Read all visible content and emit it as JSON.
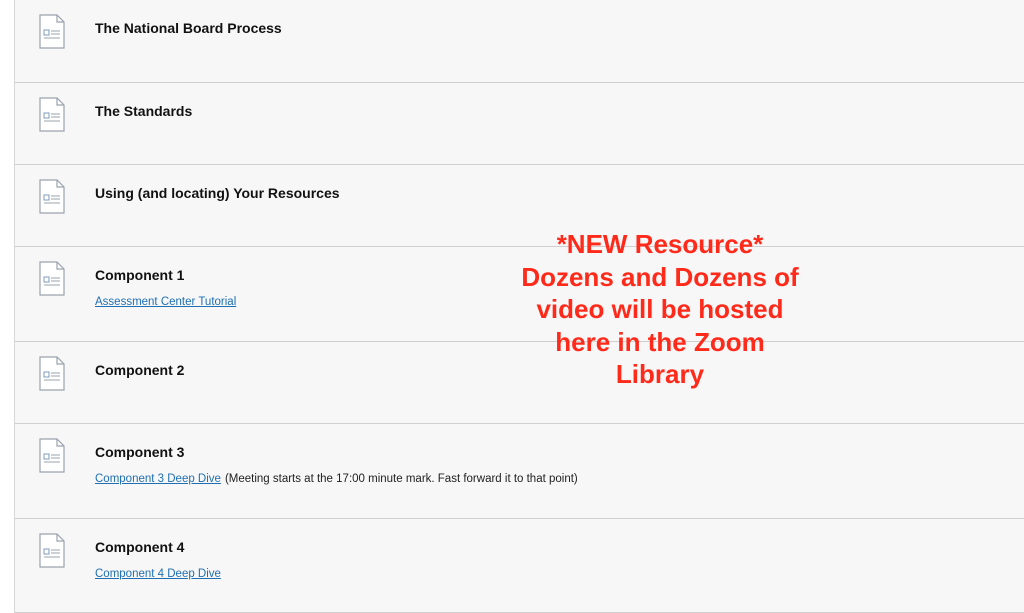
{
  "items": [
    {
      "title": "The National Board Process"
    },
    {
      "title": "The Standards"
    },
    {
      "title": "Using (and locating) Your Resources"
    },
    {
      "title": "Component 1",
      "link": "Assessment Center Tutorial"
    },
    {
      "title": "Component 2"
    },
    {
      "title": "Component 3",
      "link": "Component 3 Deep Dive",
      "note": "(Meeting starts at the 17:00 minute mark. Fast forward it to that point)"
    },
    {
      "title": "Component 4",
      "link": "Component 4 Deep Dive"
    }
  ],
  "overlay": {
    "lines": [
      "*NEW Resource*",
      "Dozens and Dozens of",
      "video will be hosted",
      "here in the Zoom",
      "Library"
    ],
    "color": "#ff2a1a"
  },
  "colors": {
    "link": "#1f6fb2",
    "background": "#f7f7f8",
    "divider": "#cfcfcf"
  },
  "icons": {
    "item_icon": "document-icon"
  }
}
